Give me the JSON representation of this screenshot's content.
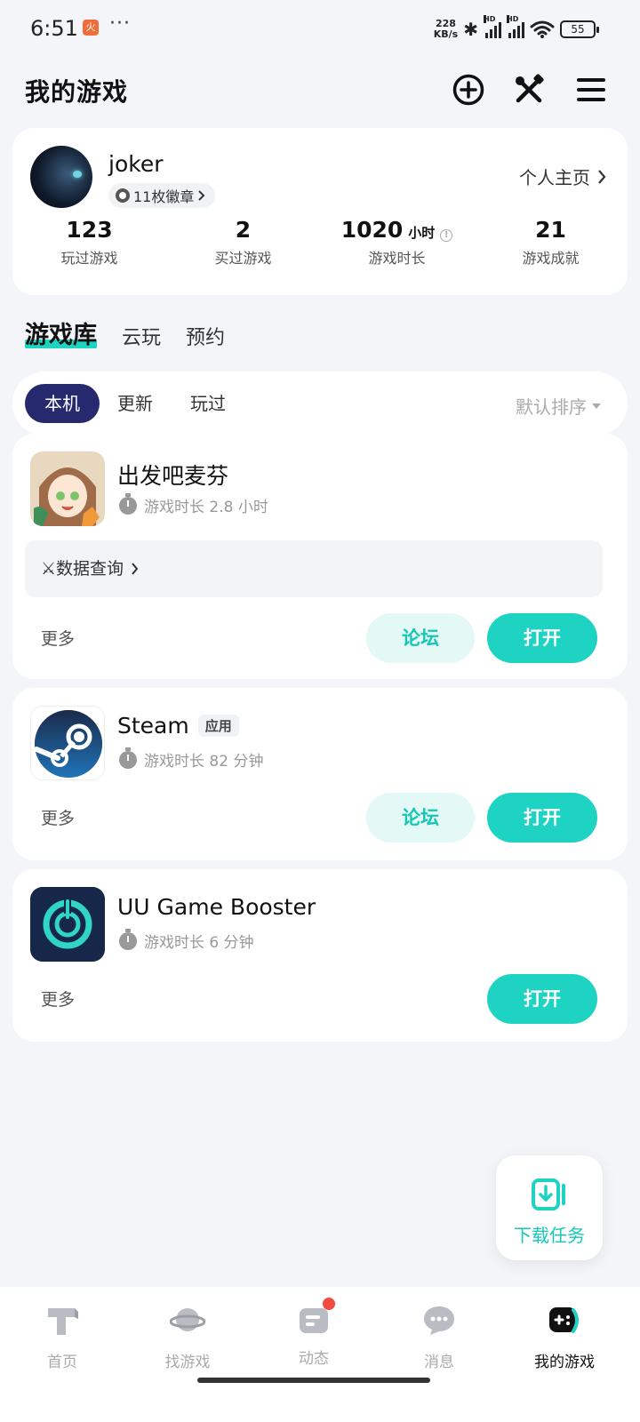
{
  "status_bar": {
    "time": "6:51",
    "net_speed_value": "228",
    "net_speed_unit": "KB/s",
    "battery": "55",
    "hd_label": "HD"
  },
  "header": {
    "title": "我的游戏"
  },
  "profile": {
    "username": "joker",
    "badges": "11枚徽章",
    "homepage_link": "个人主页",
    "stats": [
      {
        "value": "123",
        "unit": "",
        "label": "玩过游戏"
      },
      {
        "value": "2",
        "unit": "",
        "label": "买过游戏"
      },
      {
        "value": "1020",
        "unit": "小时",
        "label": "游戏时长"
      },
      {
        "value": "21",
        "unit": "",
        "label": "游戏成就"
      }
    ]
  },
  "main_tabs": [
    {
      "label": "游戏库",
      "active": true
    },
    {
      "label": "云玩",
      "active": false
    },
    {
      "label": "预约",
      "active": false
    }
  ],
  "filters": {
    "chips": [
      {
        "label": "本机",
        "active": true
      },
      {
        "label": "更新",
        "active": false
      },
      {
        "label": "玩过",
        "active": false
      }
    ],
    "sort_label": "默认排序"
  },
  "games": [
    {
      "name": "出发吧麦芬",
      "tag": "",
      "playtime": "游戏时长 2.8 小时",
      "data_query": "⚔数据查询",
      "more": "更多",
      "forum": "论坛",
      "open": "打开"
    },
    {
      "name": "Steam",
      "tag": "应用",
      "playtime": "游戏时长 82 分钟",
      "more": "更多",
      "forum": "论坛",
      "open": "打开"
    },
    {
      "name": "UU Game Booster",
      "tag": "",
      "playtime": "游戏时长 6 分钟",
      "more": "更多",
      "open": "打开"
    }
  ],
  "download_fab": {
    "label": "下载任务"
  },
  "bottom_nav": [
    {
      "label": "首页",
      "icon": "home-icon",
      "active": false
    },
    {
      "label": "找游戏",
      "icon": "planet-icon",
      "active": false
    },
    {
      "label": "动态",
      "icon": "feed-icon",
      "active": false,
      "dot": true
    },
    {
      "label": "消息",
      "icon": "message-icon",
      "active": false
    },
    {
      "label": "我的游戏",
      "icon": "gamepad-icon",
      "active": true
    }
  ],
  "colors": {
    "accent": "#1ed3c2",
    "chip_active": "#26296e",
    "badge_red": "#f24b3f"
  }
}
